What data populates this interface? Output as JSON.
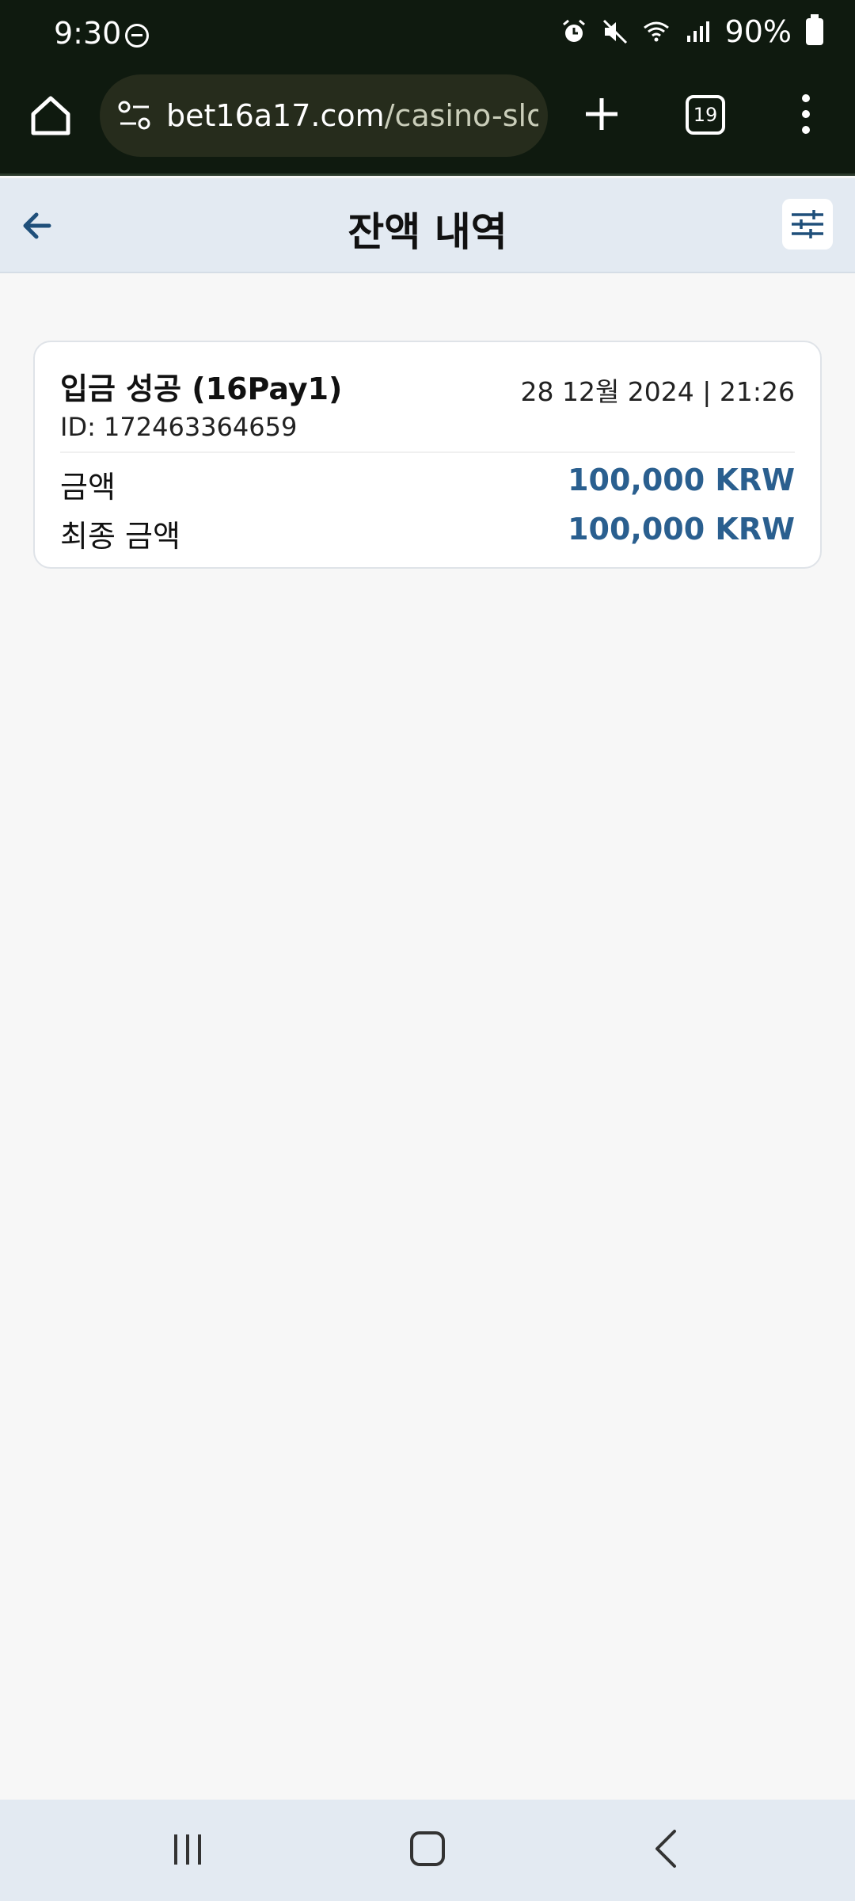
{
  "status_bar": {
    "time": "9:30",
    "battery": "90%",
    "icons": [
      "dnd-icon",
      "alarm-icon",
      "mute-icon",
      "wifi-icon",
      "signal-icon",
      "battery-icon"
    ]
  },
  "browser": {
    "url_host": "bet16a17.com",
    "url_path": "/casino-slots/",
    "tab_count": "19"
  },
  "header": {
    "title": "잔액 내역"
  },
  "transaction": {
    "title": "입금 성공 (16Pay1)",
    "date": "28 12월 2024 | 21:26",
    "id_text": "ID: 172463364659",
    "amount_label": "금액",
    "amount_value": "100,000 KRW",
    "final_label": "최종 금액",
    "final_value": "100,000 KRW"
  },
  "colors": {
    "accent": "#2a5f8f",
    "header_bg": "#e3eaf2",
    "browser_bg": "#0f1a0f"
  }
}
